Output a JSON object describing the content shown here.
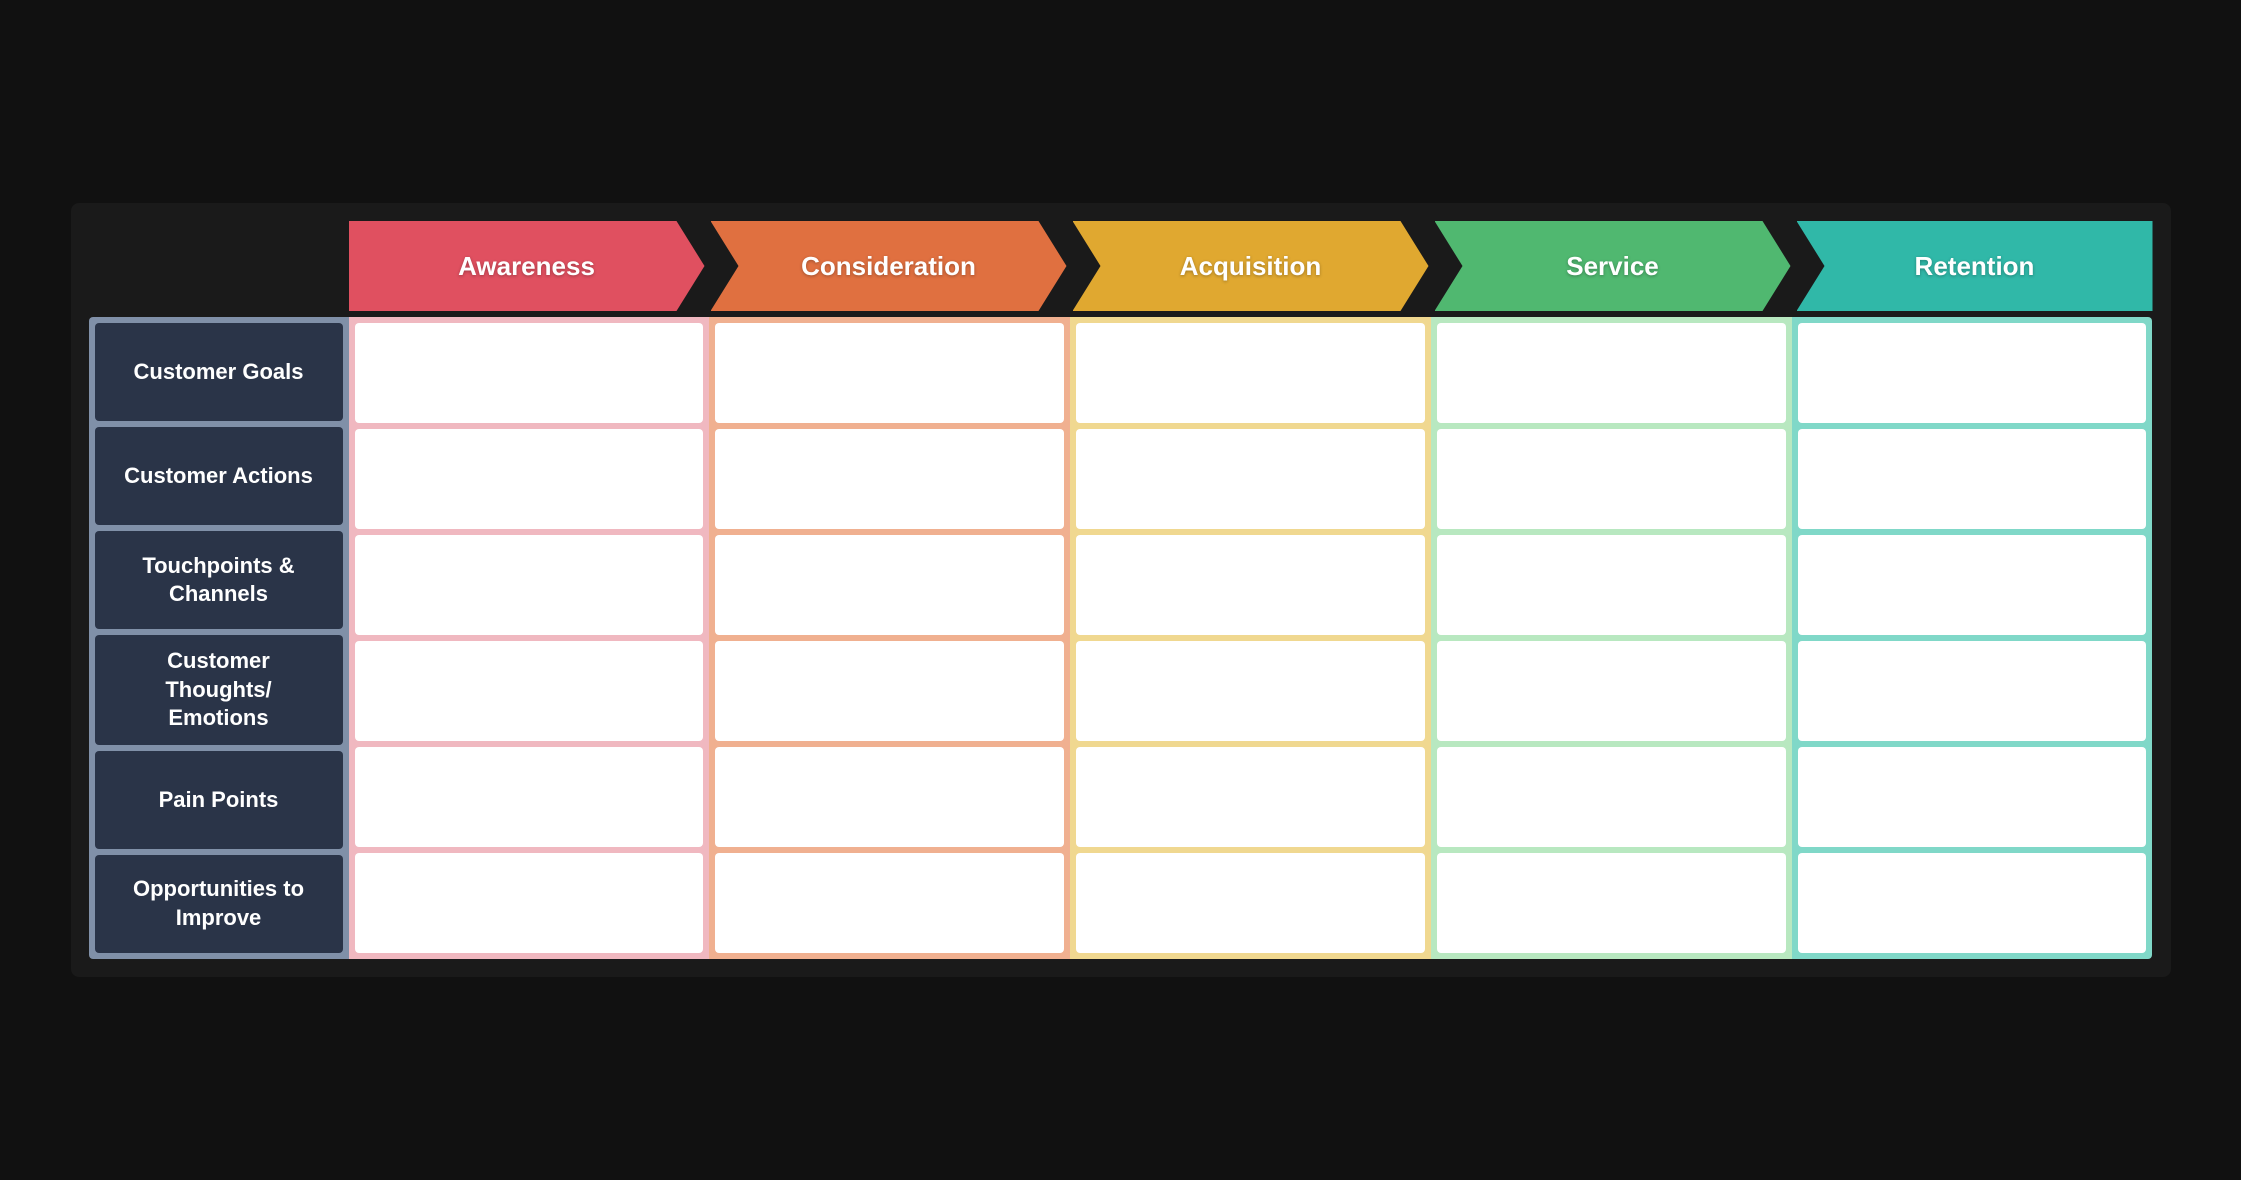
{
  "phases": [
    {
      "id": "awareness",
      "label": "Awareness",
      "colorClass": "phase-awareness",
      "colClass": "phase-col-awareness"
    },
    {
      "id": "consideration",
      "label": "Consideration",
      "colorClass": "phase-consideration",
      "colClass": "phase-col-consideration"
    },
    {
      "id": "acquisition",
      "label": "Acquisition",
      "colorClass": "phase-acquisition",
      "colClass": "phase-col-acquisition"
    },
    {
      "id": "service",
      "label": "Service",
      "colorClass": "phase-service",
      "colClass": "phase-col-service"
    },
    {
      "id": "retention",
      "label": "Retention",
      "colorClass": "phase-retention",
      "colClass": "phase-col-retention"
    }
  ],
  "rows": [
    {
      "id": "customer-goals",
      "label": "Customer Goals"
    },
    {
      "id": "customer-actions",
      "label": "Customer Actions"
    },
    {
      "id": "touchpoints-channels",
      "label": "Touchpoints &\nChannels"
    },
    {
      "id": "customer-thoughts-emotions",
      "label": "Customer\nThoughts/\nEmotions"
    },
    {
      "id": "pain-points",
      "label": "Pain Points"
    },
    {
      "id": "opportunities-to-improve",
      "label": "Opportunities to\nImprove"
    }
  ]
}
